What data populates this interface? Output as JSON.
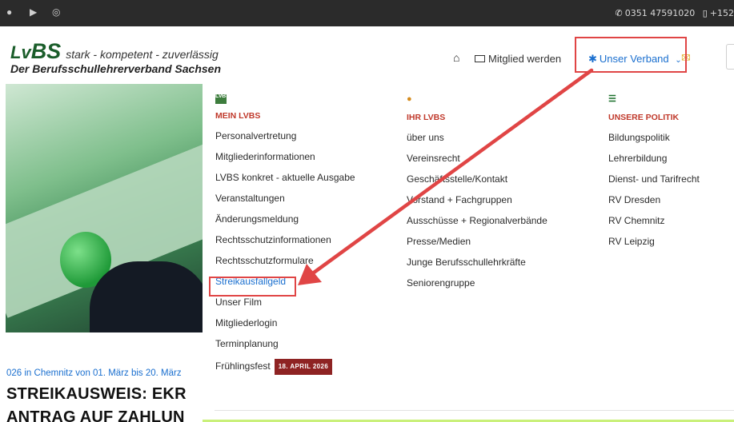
{
  "topbar": {
    "social": [
      {
        "name": "facebook-icon",
        "glyph": "f"
      },
      {
        "name": "youtube-icon",
        "glyph": "▶"
      },
      {
        "name": "instagram-icon",
        "glyph": "◎"
      }
    ],
    "phone": "0351 47591020",
    "mobile": "+152"
  },
  "header": {
    "logo_lv": "Lv",
    "logo_bs": "BS",
    "tagline": "stark - kompetent - zuverlässig",
    "subtitle": "Der Berufsschullehrerverband Sachsen"
  },
  "nav": {
    "home_icon": "home-icon",
    "member_label": "Mitglied werden",
    "verband_label": "Unser Verband",
    "mail_icon": "mail-icon"
  },
  "menu": {
    "columns": [
      {
        "icon": "lvbs-logo-icon",
        "icon_text": "LvBS",
        "title": "MEIN LVBS",
        "items": [
          "Personalvertretung",
          "Mitgliederinformationen",
          "LVBS konkret - aktuelle Ausgabe",
          "Veranstaltungen",
          "Änderungsmeldung",
          "Rechtsschutzinformationen",
          "Rechtsschutzformulare",
          "Streikausfallgeld",
          "Unser Film",
          "Mitgliederlogin",
          "Terminplanung",
          "Frühlingsfest"
        ],
        "badge": "18. APRIL 2026"
      },
      {
        "icon": "user-icon",
        "title": "IHR LVBS",
        "items": [
          "über uns",
          "Vereinsrecht",
          "Geschäftsstelle/Kontakt",
          "Vorstand + Fachgruppen",
          "Ausschüsse + Regionalverbände",
          "Presse/Medien",
          "Junge Berufsschullehrkräfte",
          "Seniorengruppe"
        ]
      },
      {
        "icon": "saxony-crest-icon",
        "title": "UNSERE POLITIK",
        "items": [
          "Bildungspolitik",
          "Lehrerbildung",
          "Dienst- und Tarifrecht",
          "RV Dresden",
          "RV Chemnitz",
          "RV Leipzig"
        ]
      }
    ]
  },
  "article": {
    "snippet": "026 in Chemnitz von 01. März bis 20. März",
    "title": "STREIKAUSWEIS: EKR",
    "title2": "ANTRAG AUF ZAHLUN"
  },
  "colors": {
    "accent": "#1a6fcf",
    "menu_heading": "#c0392b",
    "highlight": "#e04545",
    "brand_green": "#1a5d2a",
    "badge": "#8e2323"
  }
}
